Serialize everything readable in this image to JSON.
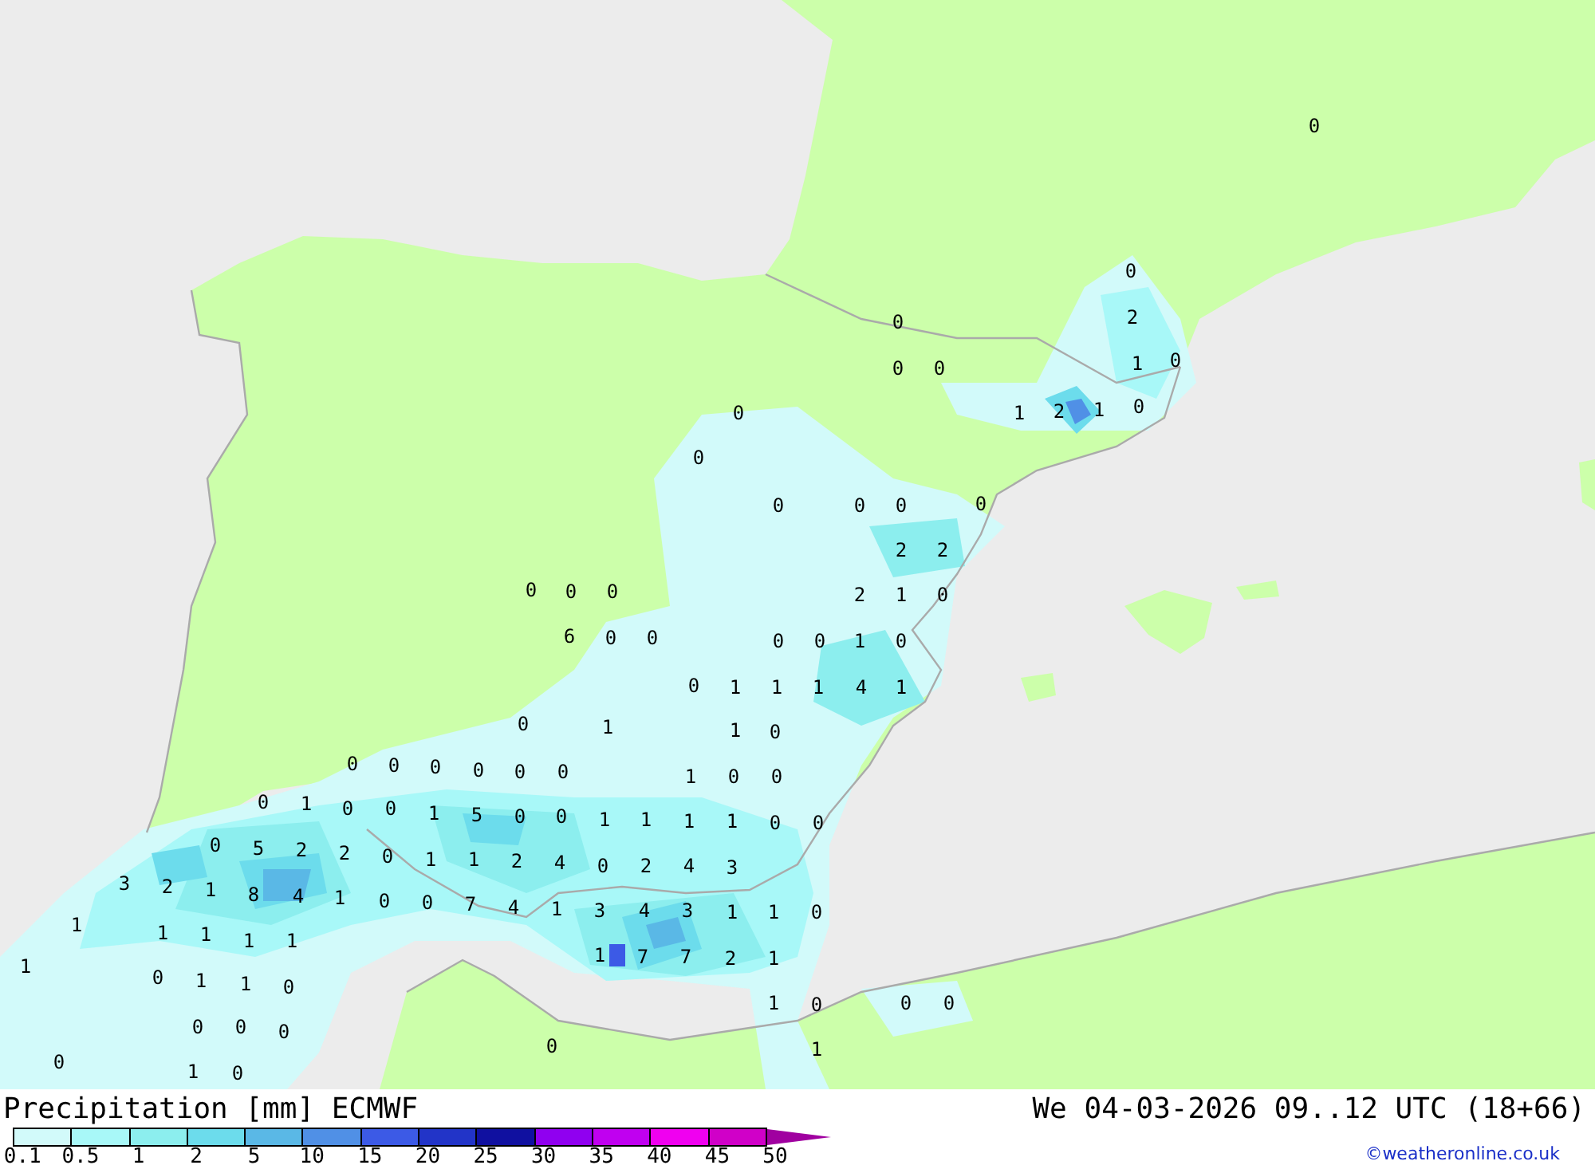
{
  "map": {
    "values": [
      "0",
      "0",
      "2",
      "0",
      "1",
      "0",
      "0",
      "0",
      "1",
      "2",
      "1",
      "0",
      "0",
      "0",
      "0",
      "0",
      "0",
      "0",
      "2",
      "2",
      "0",
      "0",
      "0",
      "2",
      "1",
      "0",
      "6",
      "0",
      "0",
      "0",
      "0",
      "1",
      "0",
      "0",
      "1",
      "1",
      "1",
      "4",
      "1",
      "0",
      "1",
      "1",
      "0",
      "0",
      "0",
      "0",
      "0",
      "0",
      "0",
      "1",
      "0",
      "0",
      "0",
      "1",
      "0",
      "0",
      "1",
      "5",
      "0",
      "0",
      "1",
      "1",
      "1",
      "1",
      "0",
      "0",
      "0",
      "5",
      "2",
      "2",
      "0",
      "1",
      "1",
      "2",
      "4",
      "0",
      "2",
      "4",
      "3",
      "3",
      "2",
      "1",
      "8",
      "4",
      "1",
      "0",
      "0",
      "7",
      "4",
      "1",
      "3",
      "4",
      "3",
      "1",
      "1",
      "0",
      "1",
      "1",
      "1",
      "1",
      "1",
      "1",
      "7",
      "7",
      "2",
      "1",
      "1",
      "0",
      "1",
      "1",
      "0",
      "1",
      "0",
      "0",
      "0",
      "0",
      "0",
      "0",
      "0",
      "1",
      "0",
      "1",
      "0"
    ]
  },
  "legend": {
    "title": "Precipitation [mm] ECMWF",
    "valid_time": "We 04-03-2026 09..12 UTC (18+66)",
    "credit": "©weatheronline.co.uk",
    "swatches": [
      {
        "color": "#d2fafa"
      },
      {
        "color": "#a8f8f8"
      },
      {
        "color": "#8ceeee"
      },
      {
        "color": "#6cdcec"
      },
      {
        "color": "#5ab8e6"
      },
      {
        "color": "#5090e6"
      },
      {
        "color": "#3c5ae6"
      },
      {
        "color": "#2234c8"
      },
      {
        "color": "#1010a0"
      },
      {
        "color": "#9000f0"
      },
      {
        "color": "#c000f0"
      },
      {
        "color": "#f000f0"
      },
      {
        "color": "#d000c8"
      },
      {
        "kind": "arrow",
        "color": "#a000a0"
      }
    ],
    "ticks": [
      "0.1",
      "0.5",
      "1",
      "2",
      "5",
      "10",
      "15",
      "20",
      "25",
      "30",
      "35",
      "40",
      "45",
      "50"
    ]
  }
}
